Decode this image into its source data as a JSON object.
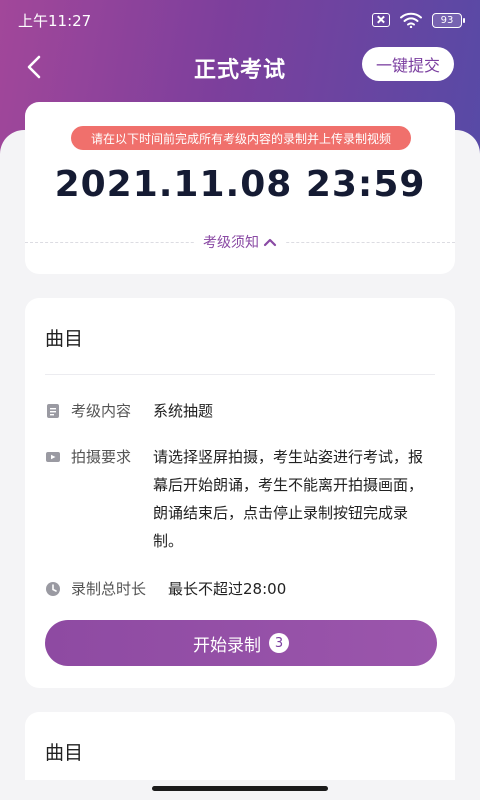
{
  "status_bar": {
    "time": "上午11:27",
    "battery": "93"
  },
  "nav": {
    "title": "正式考试",
    "submit_label": "一键提交"
  },
  "deadline": {
    "tip": "请在以下时间前完成所有考级内容的录制并上传录制视频",
    "datetime": "2021.11.08 23:59",
    "notice_label": "考级须知"
  },
  "song_card": {
    "title": "曲目",
    "content_label": "考级内容",
    "content_value": "系统抽题",
    "shoot_label": "拍摄要求",
    "shoot_value": "请选择竖屏拍摄，考生站姿进行考试，报幕后开始朗诵，考生不能离开拍摄画面，朗诵结束后，点击停止录制按钮完成录制。",
    "duration_label": "录制总时长",
    "duration_value": "最长不超过28:00",
    "record_label": "开始录制",
    "record_count": "3"
  },
  "song_card_2": {
    "title": "曲目"
  },
  "colors": {
    "accent": "#8e4aa2",
    "tip_bg": "#f0706c",
    "header_start": "#a2479a",
    "header_end": "#574aa6"
  }
}
